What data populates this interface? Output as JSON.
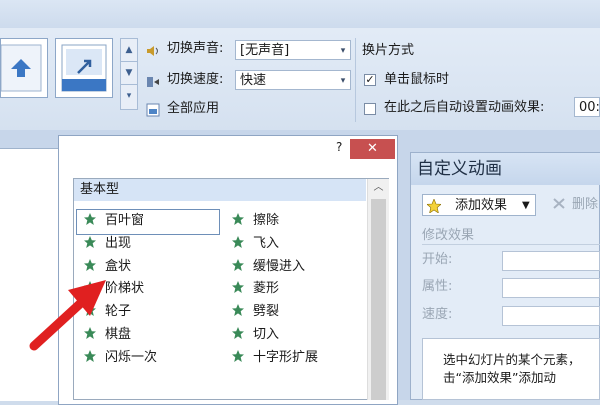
{
  "ribbon": {
    "sound_label": "切换声音:",
    "sound_value": "[无声音]",
    "speed_label": "切换速度:",
    "speed_value": "快速",
    "apply_all_label": "全部应用",
    "advance_title": "换片方式",
    "on_click_label": "单击鼠标时",
    "on_click_checked": true,
    "auto_label": "在此之后自动设置动画效果:",
    "auto_time": "00:"
  },
  "dialog": {
    "help": "?",
    "close": "✕",
    "category": "基本型",
    "effects_left": [
      "百叶窗",
      "出现",
      "盒状",
      "阶梯状",
      "轮子",
      "棋盘",
      "闪烁一次"
    ],
    "effects_right": [
      "擦除",
      "飞入",
      "缓慢进入",
      "菱形",
      "劈裂",
      "切入",
      "十字形扩展"
    ]
  },
  "custom_anim": {
    "title": "自定义动画",
    "add_effect": "添加效果",
    "delete": "删除",
    "modify_title": "修改效果",
    "start_label": "开始:",
    "property_label": "属性:",
    "speed_label": "速度:",
    "hint_line1": "选中幻灯片的某个元素，",
    "hint_line2": "击“添加效果”添加动"
  },
  "colors": {
    "accent_blue": "#d6e4f6",
    "close_red": "#c75050",
    "star_green": "#3a8a58",
    "arrow_red": "#e02020"
  }
}
